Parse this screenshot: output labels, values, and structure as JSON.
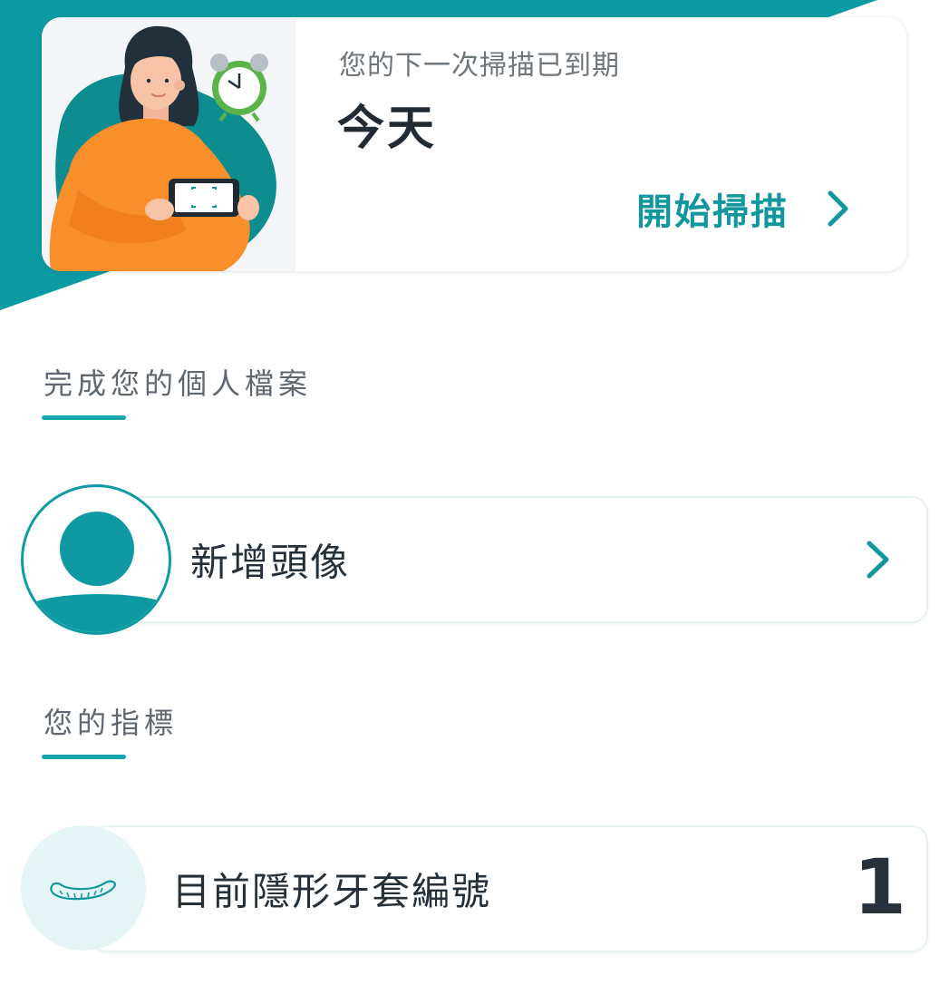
{
  "scan_card": {
    "subtitle": "您的下一次掃描已到期",
    "date": "今天",
    "action_label": "開始掃描"
  },
  "profile_section": {
    "heading": "完成您的個人檔案",
    "add_avatar_label": "新增頭像"
  },
  "metrics_section": {
    "heading": "您的指標",
    "current_aligner_label": "目前隱形牙套編號",
    "current_aligner_value": "1"
  },
  "colors": {
    "accent": "#12979e",
    "accent_light": "#e5f5f6",
    "heading_gray": "#5f6770",
    "text_dark": "#25303a"
  },
  "icons": {
    "avatar": "user-silhouette-icon",
    "aligner": "aligner-tray-icon",
    "chevron": "chevron-right-icon",
    "alarm_clock": "alarm-clock-icon"
  }
}
